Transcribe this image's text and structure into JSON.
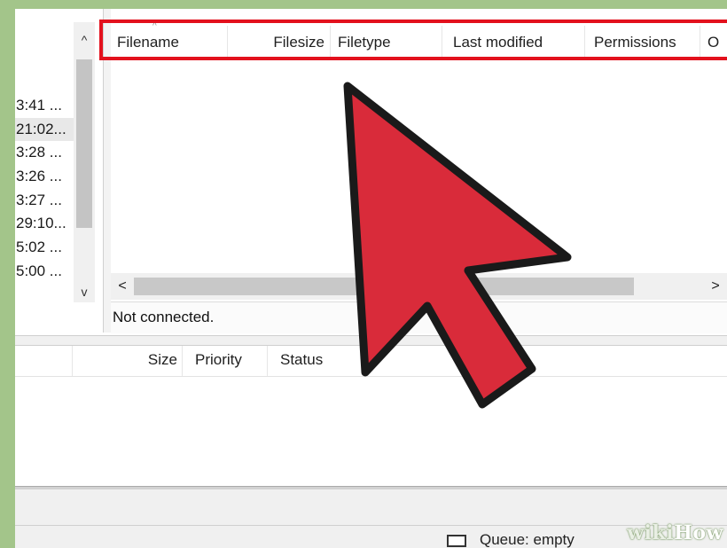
{
  "local_pane": {
    "times": [
      "3:41 ...",
      "21:02...",
      "3:28 ...",
      "3:26 ...",
      "3:27 ...",
      "29:10...",
      "5:02 ...",
      "5:00 ..."
    ],
    "scroll_up_glyph": "^",
    "scroll_down_glyph": "v"
  },
  "remote_pane": {
    "columns": [
      "Filename",
      "Filesize",
      "Filetype",
      "Last modified",
      "Permissions",
      "O"
    ],
    "sort_glyph": "^",
    "status": "Not connected.",
    "scroll_left_glyph": "<",
    "scroll_right_glyph": ">"
  },
  "queue": {
    "columns": [
      "",
      "Size",
      "Priority",
      "Status"
    ]
  },
  "status_bar": {
    "queue_text": "Queue: empty"
  },
  "watermark": {
    "wiki": "wiki",
    "how": "How"
  },
  "annotation": {
    "highlight_color": "#e3111d",
    "arrow_color": "#d92b3a"
  }
}
